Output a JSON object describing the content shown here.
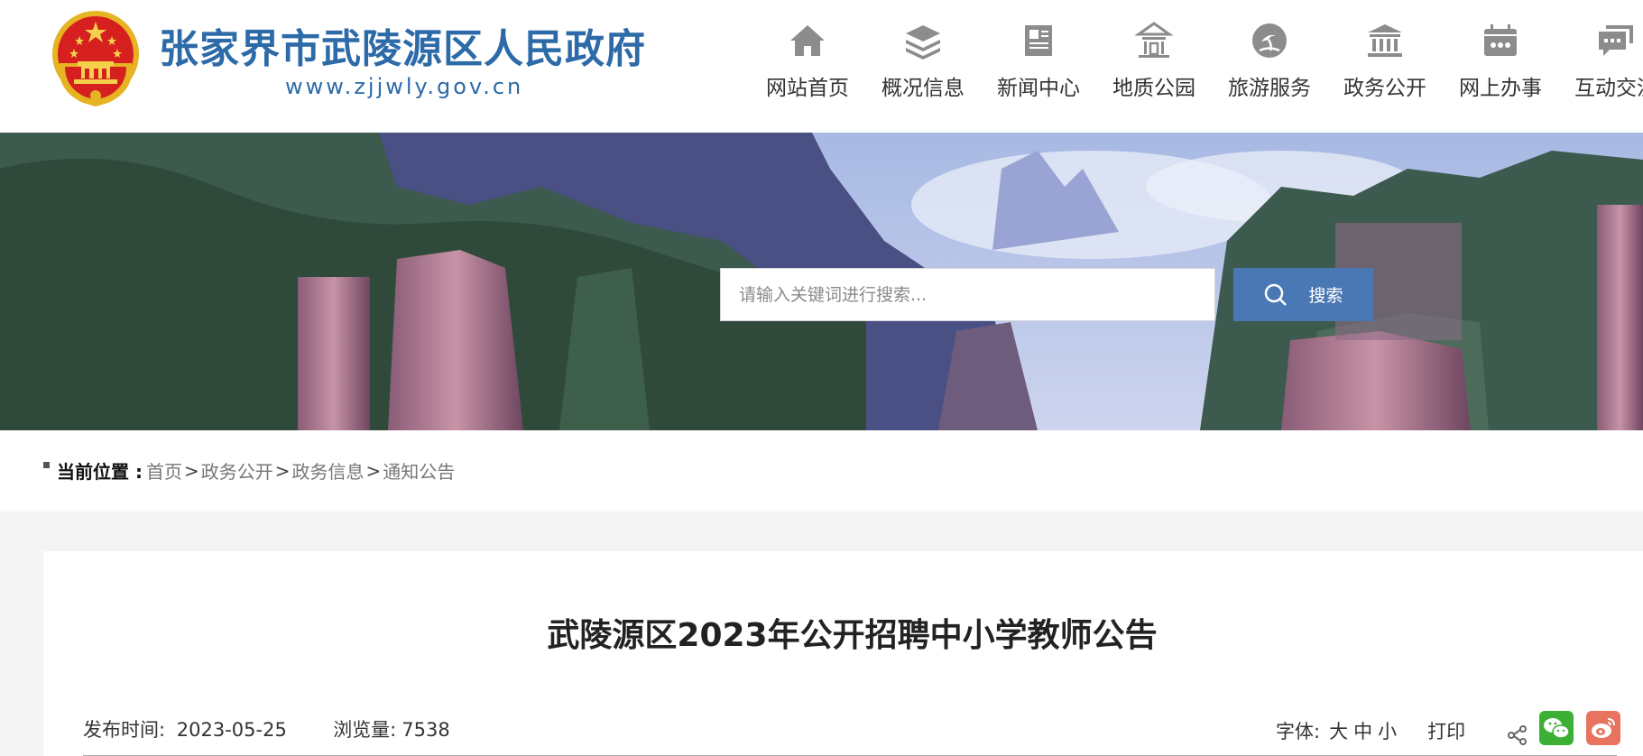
{
  "header": {
    "site_title": "张家界市武陵源区人民政府",
    "site_url": "www.zjjwly.gov.cn",
    "brand_color": "#2d6aa8"
  },
  "nav": {
    "items": [
      {
        "label": "网站首页",
        "icon": "home-icon"
      },
      {
        "label": "概况信息",
        "icon": "layers-icon"
      },
      {
        "label": "新闻中心",
        "icon": "newspaper-icon"
      },
      {
        "label": "地质公园",
        "icon": "pavilion-icon"
      },
      {
        "label": "旅游服务",
        "icon": "island-icon"
      },
      {
        "label": "政务公开",
        "icon": "government-building-icon"
      },
      {
        "label": "网上办事",
        "icon": "calendar-icon"
      },
      {
        "label": "互动交流",
        "icon": "chat-icon"
      }
    ],
    "icon_color": "#8c8c8c"
  },
  "search": {
    "placeholder": "请输入关键词进行搜索...",
    "button_label": "搜索",
    "button_color": "#4a78b5"
  },
  "breadcrumb": {
    "label": "当前位置 :",
    "items": [
      "首页",
      "政务公开",
      "政务信息",
      "通知公告"
    ],
    "separator": ">"
  },
  "article": {
    "title": "武陵源区2023年公开招聘中小学教师公告",
    "publish_label": "发布时间:",
    "publish_date": "2023-05-25",
    "views_label": "浏览量:",
    "views": "7538",
    "font_label": "字体:",
    "font_large": "大",
    "font_medium": "中",
    "font_small": "小",
    "print_label": "打印",
    "share_icons": [
      "share-icon",
      "wechat-icon",
      "weibo-icon"
    ],
    "wechat_color": "#3cb034",
    "weibo_color": "#e8735f"
  }
}
